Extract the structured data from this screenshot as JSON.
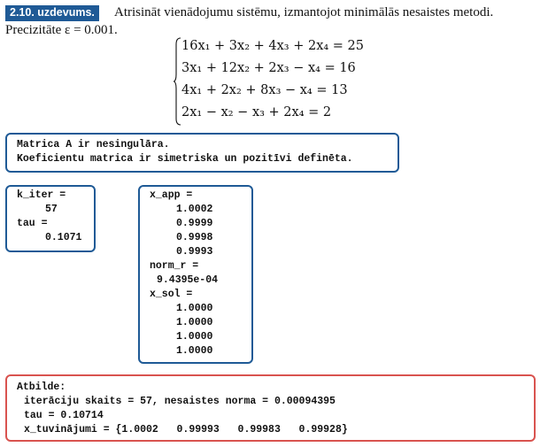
{
  "task": {
    "badge": "2.10. uzdevums.",
    "line1": "Atrisināt vienādojumu sistēmu, izmantojot minimālās nesaistes metodi.",
    "line2": "Precizitāte ε = 0.001."
  },
  "system": [
    "16x₁ + 3x₂ + 4x₃ + 2x₄ = 25",
    "3x₁ + 12x₂ + 2x₃ − x₄ = 16",
    "4x₁ + 2x₂ + 8x₃ − x₄ = 13",
    "2x₁ − x₂ − x₃ + 2x₄ = 2"
  ],
  "info": {
    "line1": "Matrica A ir nesingulāra.",
    "line2": "Koeficientu matrica ir simetriska un pozitīvi definēta."
  },
  "iter_box": {
    "k_label": "k_iter =",
    "k_value": "57",
    "tau_label": "tau =",
    "tau_value": "0.1071"
  },
  "x_box": {
    "x_app_label": "x_app =",
    "x_app": [
      "1.0002",
      "0.9999",
      "0.9998",
      "0.9993"
    ],
    "norm_label": "norm_r =",
    "norm_value": "9.4395e-04",
    "x_sol_label": "x_sol =",
    "x_sol": [
      "1.0000",
      "1.0000",
      "1.0000",
      "1.0000"
    ]
  },
  "answer": {
    "title": "Atbilde:",
    "line1": "iterāciju skaits = 57, nesaistes norma = 0.00094395",
    "line2": "tau = 0.10714",
    "line3": "x_tuvinājumi = {1.0002   0.99993   0.99983   0.99928}"
  }
}
